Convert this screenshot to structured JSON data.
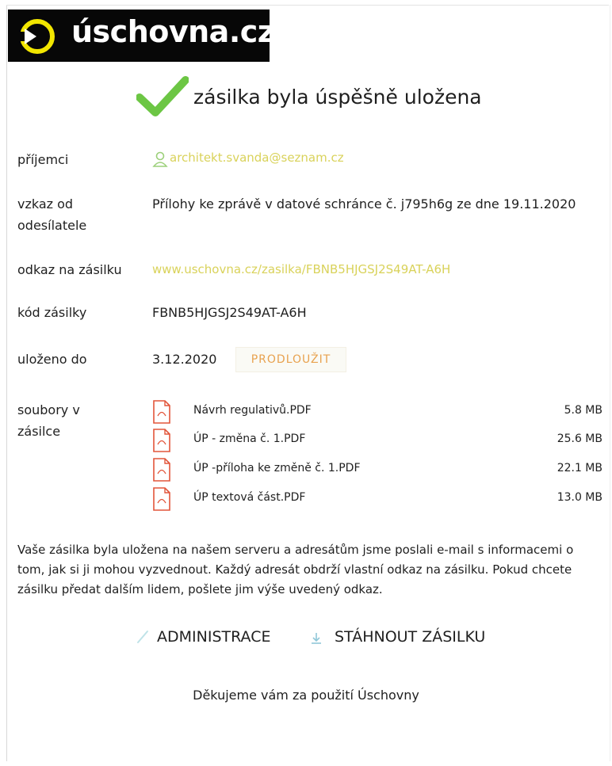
{
  "header": {
    "logo_text": "úschovna.cz",
    "logo_mark_icon": "play-ring-icon",
    "logo_colors": {
      "background": "#070707",
      "accent": "#f2e600",
      "text": "#ffffff"
    }
  },
  "status": {
    "icon": "checkmark-icon",
    "icon_color": "#6cc644",
    "headline": "zásilka byla úspěšně uložena"
  },
  "details": {
    "recipients": {
      "label": "příjemci",
      "icon": "person-icon",
      "value": "architekt.svanda@seznam.cz"
    },
    "message": {
      "label_line1": "vzkaz od",
      "label_line2": "odesílatele",
      "value": "Přílohy ke zprávě v datové schránce č. j795h6g ze dne 19.11.2020"
    },
    "link": {
      "label": "odkaz na zásilku",
      "value": "www.uschovna.cz/zasilka/FBNB5HJGSJ2S49AT-A6H"
    },
    "code": {
      "label": "kód zásilky",
      "value": "FBNB5HJGSJ2S49AT-A6H"
    },
    "stored_until": {
      "label": "uloženo do",
      "value": "3.12.2020",
      "extend_button": "PRODLOUŽIT"
    },
    "files": {
      "label_line1": "soubory v",
      "label_line2": "zásilce",
      "icon": "pdf-file-icon",
      "items": [
        {
          "name": "Návrh regulativů.PDF",
          "size": "5.8 MB"
        },
        {
          "name": "ÚP - změna č. 1.PDF",
          "size": "25.6 MB"
        },
        {
          "name": "ÚP -příloha ke změně č. 1.PDF",
          "size": "22.1 MB"
        },
        {
          "name": "ÚP textová část.PDF",
          "size": "13.0 MB"
        }
      ]
    }
  },
  "info_text": "Vaše zásilka byla uložena na našem serveru a adresátům jsme poslali e-mail s informacemi o tom, jak si ji mohou vyzvednout. Každý adresát obdrží vlastní odkaz na zásilku. Pokud chcete zásilku předat dalším lidem, pošlete jim výše uvedený odkaz.",
  "actions": {
    "admin": {
      "icon": "pencil-icon",
      "label": "ADMINISTRACE"
    },
    "download": {
      "icon": "download-icon",
      "label": "STÁHNOUT ZÁSILKU"
    }
  },
  "footer": {
    "thanks": "Děkujeme vám za použití Úschovny"
  }
}
